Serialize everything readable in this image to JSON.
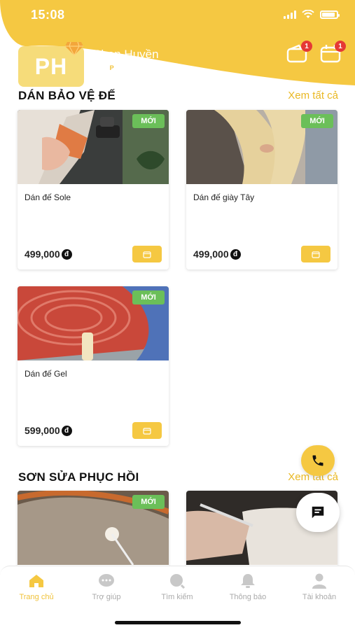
{
  "status_bar": {
    "time": "15:08"
  },
  "user": {
    "initials": "PH",
    "name": "Phan Huyền",
    "points": "0.0",
    "points_symbol": "P"
  },
  "header_icons": [
    {
      "name": "wallet-icon",
      "badge": "1"
    },
    {
      "name": "calendar-icon",
      "badge": "1"
    }
  ],
  "sections": [
    {
      "title": "DÁN BẢO VỆ ĐẾ",
      "see_all": "Xem tất cả",
      "products": [
        {
          "name": "Dán đế Sole",
          "price": "499,000",
          "badge": "MỚI"
        },
        {
          "name": "Dán đế giày Tây",
          "price": "499,000",
          "badge": "MỚI"
        },
        {
          "name": "Dán đế Gel",
          "price": "599,000",
          "badge": "MỚI"
        }
      ]
    },
    {
      "title": "SƠN SỬA PHỤC HỒI",
      "see_all": "Xem tất cả",
      "products": [
        {
          "badge": "MỚI"
        }
      ]
    }
  ],
  "currency_symbol": "đ",
  "bottom_nav": [
    {
      "label": "Trang chủ",
      "icon": "home-icon",
      "active": true
    },
    {
      "label": "Trợ giúp",
      "icon": "help-chat-icon",
      "active": false
    },
    {
      "label": "Tìm kiếm",
      "icon": "search-icon",
      "active": false
    },
    {
      "label": "Thông báo",
      "icon": "bell-icon",
      "active": false
    },
    {
      "label": "Tài khoản",
      "icon": "user-icon",
      "active": false
    }
  ],
  "colors": {
    "brand_yellow": "#f5c842",
    "accent_text": "#e9b823",
    "badge_green": "#6bbf59",
    "badge_red": "#e53935"
  }
}
